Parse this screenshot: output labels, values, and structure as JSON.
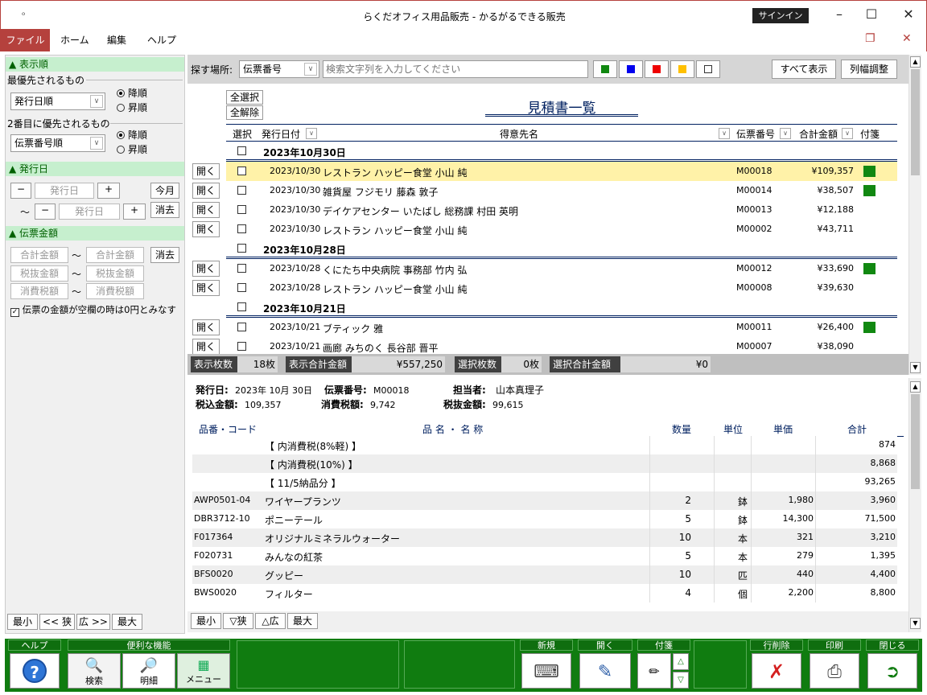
{
  "window": {
    "title": "らくだオフィス用品販売  -  かるがるできる販売",
    "signin": "サインイン",
    "quick_access": "ₒ"
  },
  "ribbon": {
    "tabs": [
      "ファイル",
      "ホーム",
      "編集",
      "ヘルプ"
    ]
  },
  "left": {
    "sort_header": "▲ 表示順",
    "priority1_label": "最優先されるもの",
    "priority1_value": "発行日順",
    "priority2_label": "2番目に優先されるもの",
    "priority2_value": "伝票番号順",
    "desc": "降順",
    "asc": "昇順",
    "date_header": "▲ 発行日",
    "date_placeholder": "発行日",
    "minus": "−",
    "plus": "+",
    "tilde": "〜",
    "this_month": "今月",
    "clear": "消去",
    "amount_header": "▲ 伝票金額",
    "total_amount": "合計金額",
    "pretax_amount": "税抜金額",
    "tax_amount": "消費税額",
    "zero_note": "伝票の金額が空欄の時は0円とみなす",
    "zoom": [
      "最小",
      "<< 狭",
      "広 >>",
      "最大"
    ]
  },
  "search": {
    "label": "探す場所:",
    "field": "伝票番号",
    "placeholder": "検索文字列を入力してください",
    "show_all": "すべて表示",
    "adjust_cols": "列幅調整"
  },
  "list": {
    "select_all": "全選択",
    "deselect_all": "全解除",
    "title": "見積書一覧",
    "headers": {
      "select": "選択",
      "date": "発行日付",
      "customer": "得意先名",
      "number": "伝票番号",
      "total": "合計金額",
      "tag": "付箋"
    },
    "open_label": "開く",
    "groups": [
      {
        "title": "2023年10月30日",
        "rows": [
          {
            "date": "2023/10/30",
            "customer": "レストラン ハッピー食堂 小山 純",
            "number": "M00018",
            "total": "¥109,357",
            "tag": true,
            "highlight": true
          },
          {
            "date": "2023/10/30",
            "customer": "雑貨屋 フジモリ 藤森 敦子",
            "number": "M00014",
            "total": "¥38,507",
            "tag": true
          },
          {
            "date": "2023/10/30",
            "customer": "デイケアセンター いたばし 総務課 村田 英明",
            "number": "M00013",
            "total": "¥12,188",
            "tag": false
          },
          {
            "date": "2023/10/30",
            "customer": "レストラン ハッピー食堂 小山 純",
            "number": "M00002",
            "total": "¥43,711",
            "tag": false
          }
        ]
      },
      {
        "title": "2023年10月28日",
        "rows": [
          {
            "date": "2023/10/28",
            "customer": "くにたち中央病院 事務部 竹内 弘",
            "number": "M00012",
            "total": "¥33,690",
            "tag": true
          },
          {
            "date": "2023/10/28",
            "customer": "レストラン ハッピー食堂 小山 純",
            "number": "M00008",
            "total": "¥39,630",
            "tag": false
          }
        ]
      },
      {
        "title": "2023年10月21日",
        "rows": [
          {
            "date": "2023/10/21",
            "customer": "ブティック 雅",
            "number": "M00011",
            "total": "¥26,400",
            "tag": true
          },
          {
            "date": "2023/10/21",
            "customer": "画廊 みちのく 長谷部 晋平",
            "number": "M00007",
            "total": "¥38,090",
            "tag": false
          }
        ]
      }
    ]
  },
  "summary": {
    "count_label": "表示枚数",
    "count": "18枚",
    "total_label": "表示合計金額",
    "total": "¥557,250",
    "sel_count_label": "選択枚数",
    "sel_count": "0枚",
    "sel_total_label": "選択合計金額",
    "sel_total": "¥0"
  },
  "detail": {
    "date_label": "発行日:",
    "date": "2023年 10月 30日",
    "number_label": "伝票番号:",
    "number": "M00018",
    "person_label": "担当者:",
    "person": "山本真理子",
    "taxin_label": "税込金額:",
    "taxin": "109,357",
    "tax_label": "消費税額:",
    "tax": "9,742",
    "pretax_label": "税抜金額:",
    "pretax": "99,615",
    "headers": {
      "code": "品番・コード",
      "name": "品 名 ・ 名 称",
      "qty": "数量",
      "unit": "単位",
      "price": "単価",
      "total": "合計"
    },
    "rows": [
      {
        "code": "",
        "name": "【 内消費税(8%軽) 】",
        "qty": "",
        "unit": "",
        "price": "",
        "total": "874"
      },
      {
        "code": "",
        "name": "【 内消費税(10%) 】",
        "qty": "",
        "unit": "",
        "price": "",
        "total": "8,868"
      },
      {
        "code": "",
        "name": "【 11/5納品分 】",
        "qty": "",
        "unit": "",
        "price": "",
        "total": "93,265"
      },
      {
        "code": "AWP0501-04",
        "name": "ワイヤープランツ",
        "qty": "2",
        "unit": "鉢",
        "price": "1,980",
        "total": "3,960"
      },
      {
        "code": "DBR3712-10",
        "name": "ポニーテール",
        "qty": "5",
        "unit": "鉢",
        "price": "14,300",
        "total": "71,500"
      },
      {
        "code": "F017364",
        "name": "オリジナルミネラルウォーター",
        "qty": "10",
        "unit": "本",
        "price": "321",
        "total": "3,210"
      },
      {
        "code": "F020731",
        "name": "みんなの紅茶",
        "qty": "5",
        "unit": "本",
        "price": "279",
        "total": "1,395"
      },
      {
        "code": "BFS0020",
        "name": "グッピー",
        "qty": "10",
        "unit": "匹",
        "price": "440",
        "total": "4,400"
      },
      {
        "code": "BWS0020",
        "name": "フィルター",
        "qty": "4",
        "unit": "個",
        "price": "2,200",
        "total": "8,800"
      }
    ],
    "zoom": [
      "最小",
      "▽狭",
      "△広",
      "最大"
    ]
  },
  "toolbar": {
    "help": "ヘルプ",
    "tools": "便利な機能",
    "search": "検索",
    "detail": "明細",
    "menu": "メニュー",
    "new": "新規",
    "open": "開く",
    "tag": "付箋",
    "delete": "行削除",
    "print": "印刷",
    "close": "閉じる"
  },
  "colors": {
    "accent": "#b5413d",
    "toolbar": "#107c10",
    "section": "#c6efce",
    "highlight": "#fff2a8",
    "tag": "#118811"
  }
}
